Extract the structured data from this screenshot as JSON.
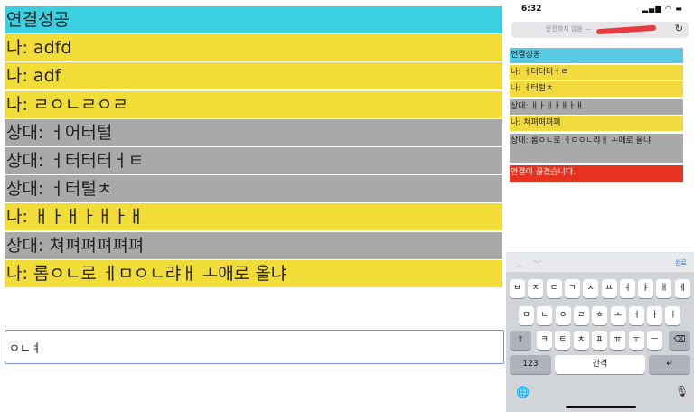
{
  "chat": {
    "messages": [
      {
        "type": "connected",
        "text": "연결성공"
      },
      {
        "type": "me",
        "text": "나: adfd"
      },
      {
        "type": "me",
        "text": "나: adf"
      },
      {
        "type": "me",
        "text": "나: ㄹㅇㄴㄹㅇㄹ"
      },
      {
        "type": "peer",
        "text": "상대: ㅓ어터털"
      },
      {
        "type": "peer",
        "text": "상대: ㅓ터터터ㅓㅌ"
      },
      {
        "type": "peer",
        "text": "상대: ㅓ터털ㅊ"
      },
      {
        "type": "me",
        "text": "나: ㅐㅏㅐㅏㅐㅏㅐ"
      },
      {
        "type": "peer",
        "text": "상대: 쳐펴펴펴펴펴"
      },
      {
        "type": "me",
        "text": "나: 롬ㅇㄴ로 ㅔㅁㅇㄴ랴ㅐ ㅗ애로 올냐"
      }
    ],
    "input_value": "ㅇㄴㅕ"
  },
  "phone": {
    "status_time": "6:32",
    "status_icons": "▂▄▆ ◠ ▬",
    "address_text": "안전하지 않음 —",
    "reload_icon": "↻",
    "messages": [
      {
        "type": "connected",
        "text": "연결성공"
      },
      {
        "type": "me",
        "text": "나: ㅓ터터터ㅓㅌ"
      },
      {
        "type": "me",
        "text": "나: ㅓ터털ㅊ"
      },
      {
        "type": "peer",
        "text": "상대: ㅐㅏㅐㅏㅐㅏㅐ"
      },
      {
        "type": "me",
        "text": "나: 쳐펴펴펴펴"
      },
      {
        "type": "peer",
        "text": "상대: 롬ㅇㄴ로 ㅔㅁㅇㄴ랴ㅐ ㅗ애로 올냐"
      },
      {
        "type": "alert",
        "text": "연결이 끊겼습니다."
      }
    ],
    "keyboard": {
      "toolbar_up": "︿",
      "toolbar_down": "﹀",
      "done_label": "완료",
      "row1": [
        "ㅂ",
        "ㅈ",
        "ㄷ",
        "ㄱ",
        "ㅅ",
        "ㅛ",
        "ㅕ",
        "ㅑ",
        "ㅐ",
        "ㅔ"
      ],
      "row2": [
        "ㅁ",
        "ㄴ",
        "ㅇ",
        "ㄹ",
        "ㅎ",
        "ㅗ",
        "ㅓ",
        "ㅏ",
        "ㅣ"
      ],
      "row3": [
        "ㅋ",
        "ㅌ",
        "ㅊ",
        "ㅍ",
        "ㅠ",
        "ㅜ",
        "ㅡ"
      ],
      "shift_icon": "⇧",
      "backspace_icon": "⌫",
      "numbers_label": "123",
      "space_label": "간격",
      "return_icon": "↵",
      "globe_icon": "🌐",
      "mic_icon": "🎙"
    }
  }
}
